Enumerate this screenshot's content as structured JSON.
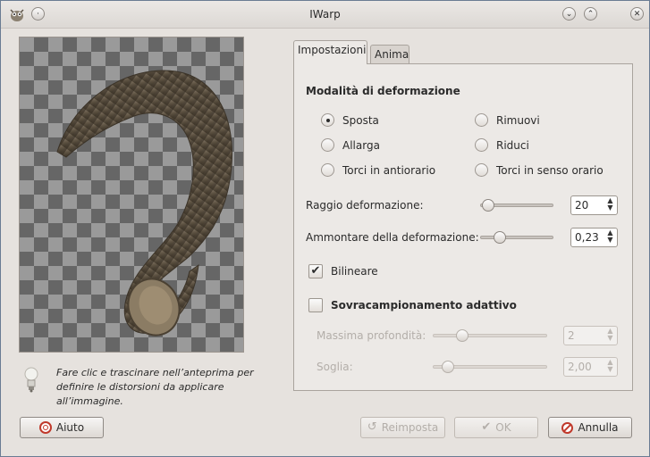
{
  "window": {
    "title": "IWarp"
  },
  "hint": "Fare clic e trascinare nell’anteprima per definire le distorsioni da applicare all’immagine.",
  "tabs": [
    {
      "label": "Impostazioni",
      "active": true
    },
    {
      "label": "Anima",
      "active": false
    }
  ],
  "settings": {
    "section_title": "Modalità di deformazione",
    "modes": [
      {
        "label": "Sposta",
        "checked": true
      },
      {
        "label": "Rimuovi",
        "checked": false
      },
      {
        "label": "Allarga",
        "checked": false
      },
      {
        "label": "Riduci",
        "checked": false
      },
      {
        "label": "Torci in antiorario",
        "checked": false
      },
      {
        "label": "Torci in senso orario",
        "checked": false
      }
    ],
    "radius": {
      "label": "Raggio deformazione:",
      "value": "20"
    },
    "amount": {
      "label": "Ammontare della deformazione:",
      "value": "0,23"
    },
    "bilinear": {
      "label": "Bilineare",
      "checked": true
    },
    "supersample": {
      "label": "Sovracampionamento adattivo",
      "checked": false
    },
    "max_depth": {
      "label": "Massima profondità:",
      "value": "2"
    },
    "threshold": {
      "label": "Soglia:",
      "value": "2,00"
    }
  },
  "buttons": {
    "help": "Aiuto",
    "reset": "Reimposta",
    "ok": "OK",
    "cancel": "Annulla"
  }
}
